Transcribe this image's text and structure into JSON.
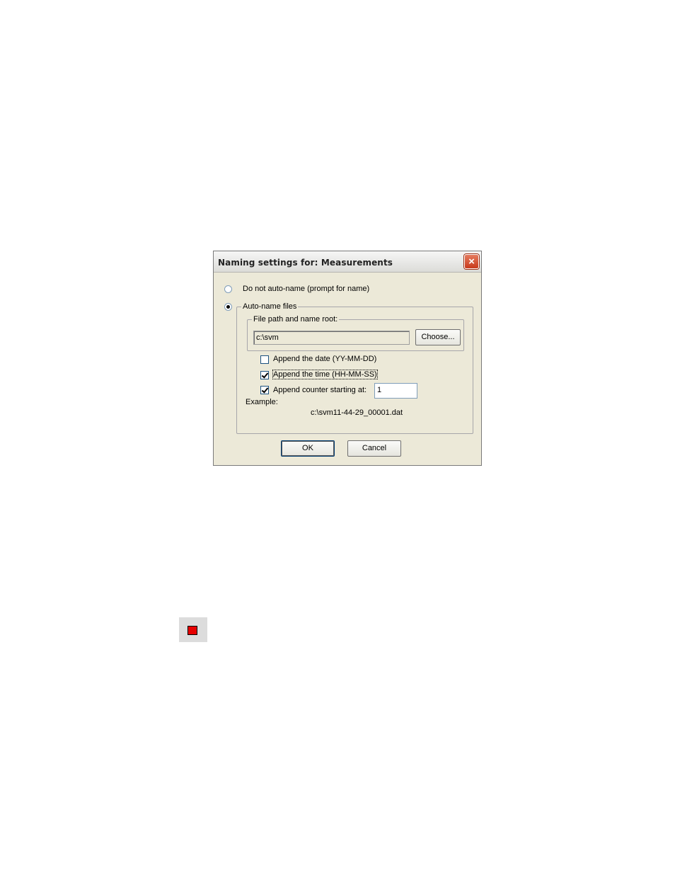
{
  "dialog": {
    "title": "Naming settings for: Measurements",
    "close_label": "×",
    "option_no_autoname": "Do not auto-name (prompt for name)",
    "option_autoname": "Auto-name files",
    "path_group_label": "File path and name root:",
    "path_value": "c:\\svm",
    "choose_label": "Choose...",
    "append_date_label": "Append the date (YY-MM-DD)",
    "append_time_label": "Append the time (HH-MM-SS)",
    "append_counter_label": "Append counter starting at:",
    "counter_value": "1",
    "example_label": "Example:",
    "example_value": "c:\\svm11-44-29_00001.dat",
    "ok_label": "OK",
    "cancel_label": "Cancel"
  },
  "state": {
    "selected_option": "autoname",
    "append_date": false,
    "append_time": true,
    "append_counter": true
  },
  "colors": {
    "dialog_bg": "#ece9d8",
    "close_red": "#c8391b",
    "stop_red": "#e60000"
  },
  "icons": {
    "close": "close-icon",
    "stop": "stop-icon"
  }
}
